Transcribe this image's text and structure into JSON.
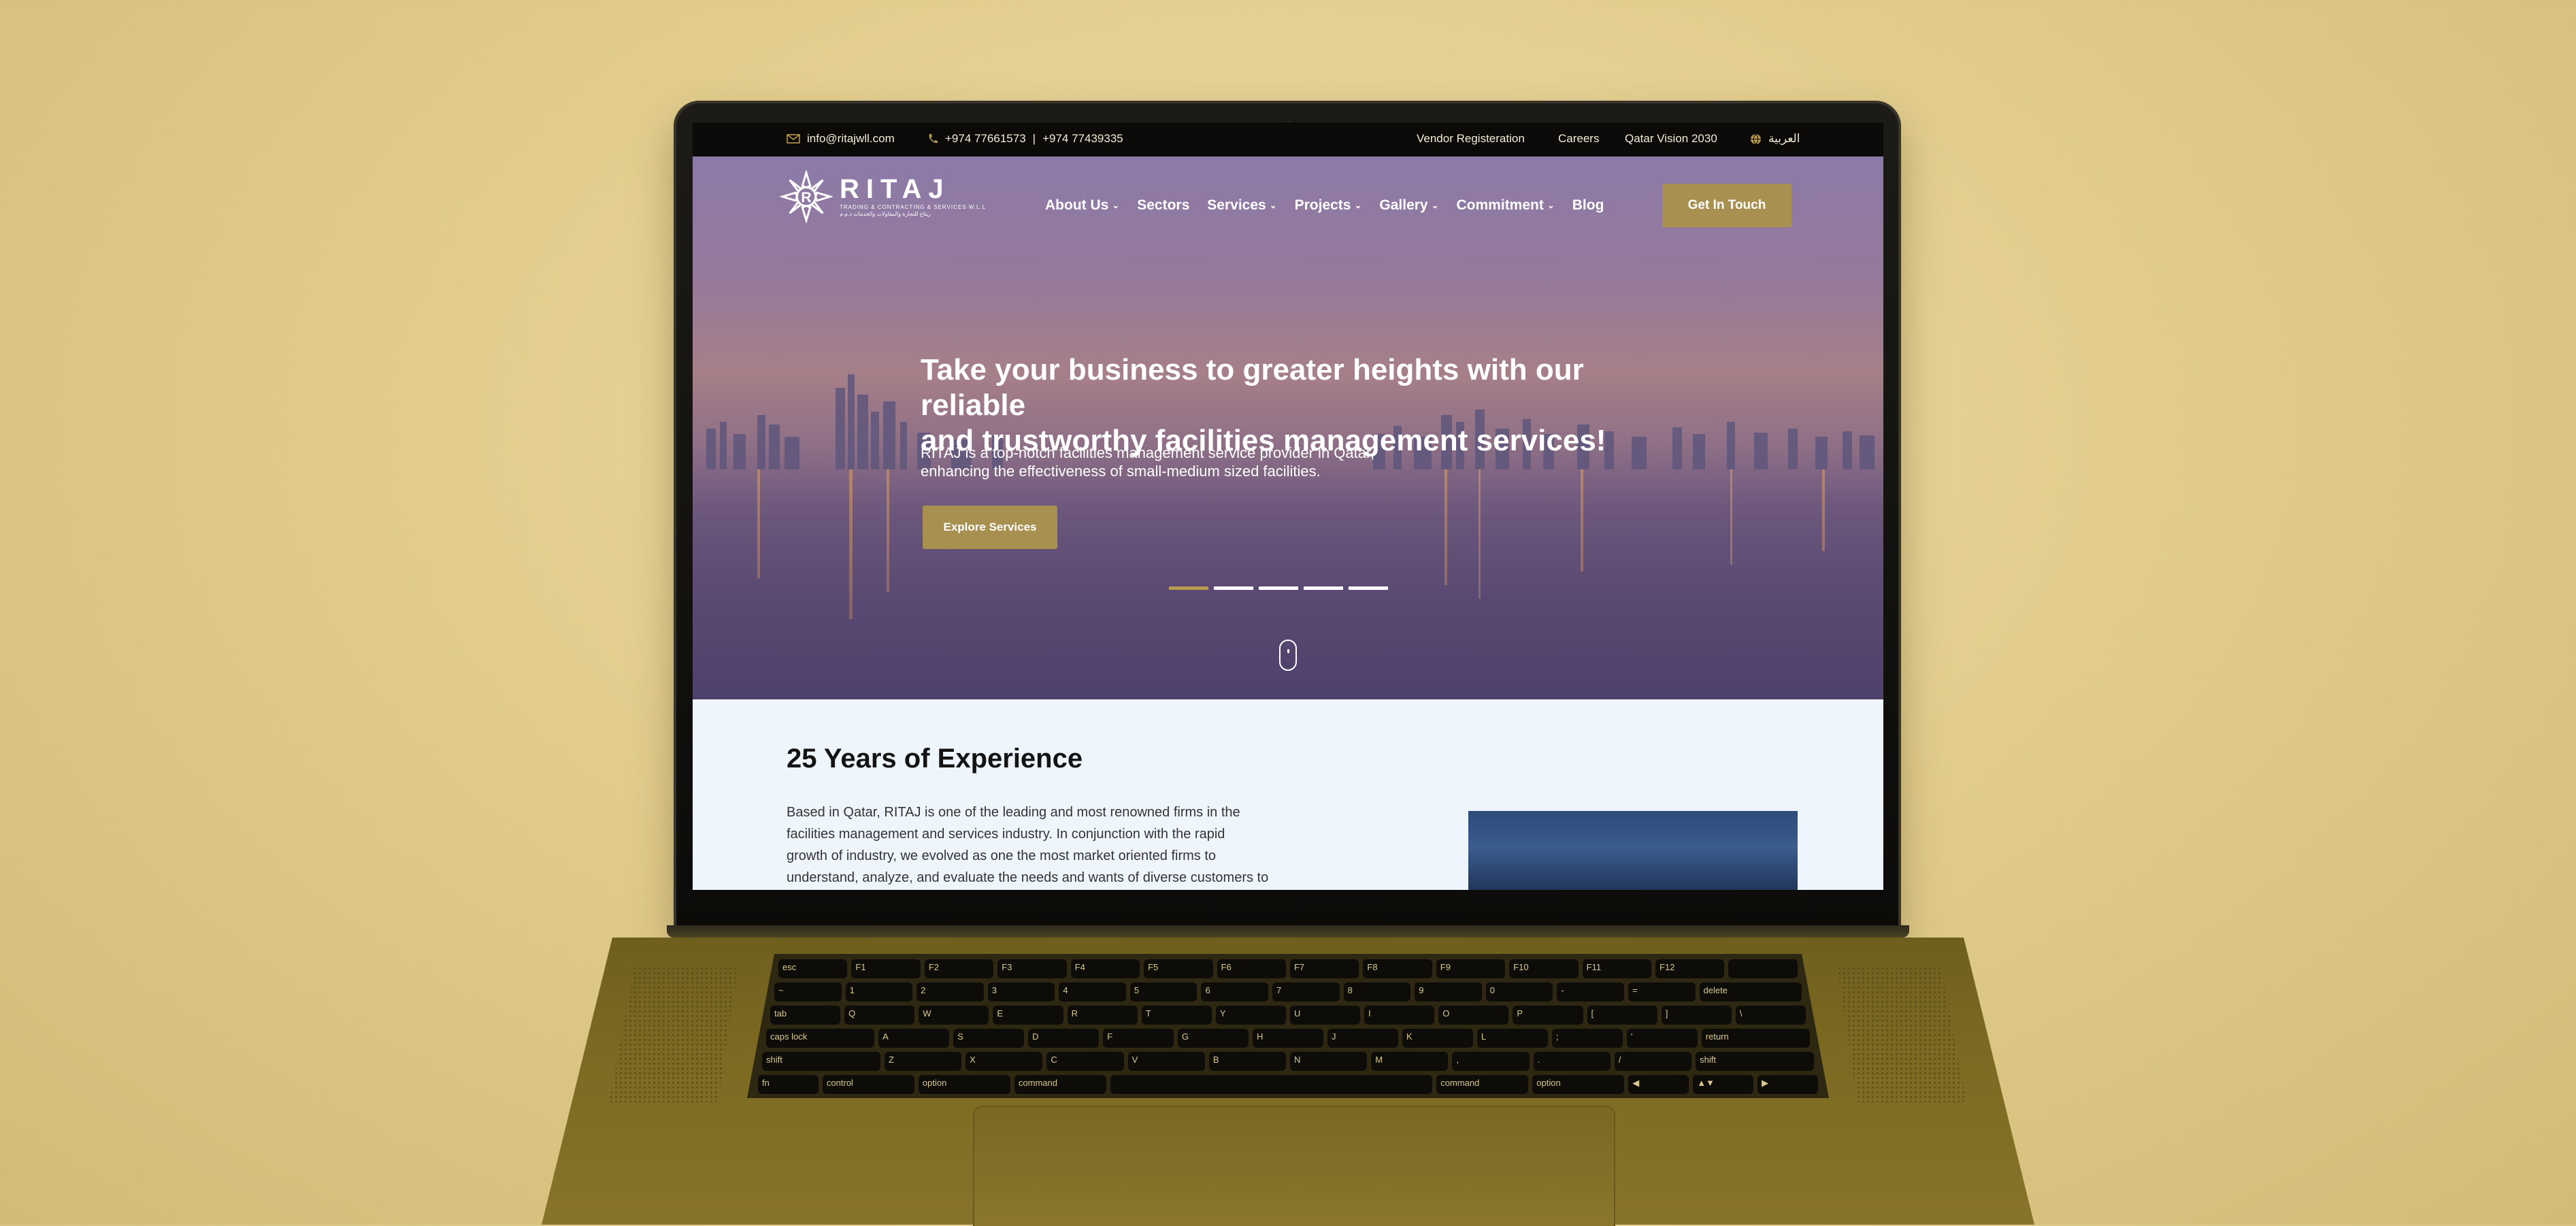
{
  "topbar": {
    "email": "info@ritajwll.com",
    "phone1": "+974 77661573",
    "separator": "|",
    "phone2": "+974 77439335",
    "links": [
      "Vendor Registeration",
      "Careers",
      "Qatar Vision 2030"
    ],
    "language": "العربية"
  },
  "brand": {
    "name": "RITAJ",
    "tagline": "TRADING & CONTRACTING & SERVICES W.L.L",
    "tagline_ar": "ريتاج للتجارة والمقاولات والخدمات ذ.م.م"
  },
  "nav": {
    "items": [
      {
        "label": "About Us",
        "dropdown": true
      },
      {
        "label": "Sectors",
        "dropdown": false
      },
      {
        "label": "Services",
        "dropdown": true
      },
      {
        "label": "Projects",
        "dropdown": true
      },
      {
        "label": "Gallery",
        "dropdown": true
      },
      {
        "label": "Commitment",
        "dropdown": true
      },
      {
        "label": "Blog",
        "dropdown": false
      }
    ],
    "cta": "Get In Touch",
    "caret": "⌄"
  },
  "hero": {
    "title_line1": "Take your business to greater heights with our reliable",
    "title_line2": "and trustworthy facilities management services!",
    "sub_line1": "RITAJ is a top-notch facilities management service provider in Qatar,",
    "sub_line2": "enhancing the effectiveness of small-medium sized facilities.",
    "button": "Explore Services",
    "slides": 5,
    "active_slide": 1
  },
  "about": {
    "title": "25 Years of Experience",
    "lines": [
      "Based in Qatar, RITAJ is one of the leading and most renowned firms in the",
      "facilities management and services industry. In conjunction with the rapid",
      "growth of industry, we evolved as one the most market oriented firms to",
      "understand, analyze, and evaluate the needs and wants of diverse customers to"
    ]
  },
  "keyboard": {
    "row1": [
      "esc",
      "F1",
      "F2",
      "F3",
      "F4",
      "F5",
      "F6",
      "F7",
      "F8",
      "F9",
      "F10",
      "F11",
      "F12",
      ""
    ],
    "row2": [
      "~",
      "1",
      "2",
      "3",
      "4",
      "5",
      "6",
      "7",
      "8",
      "9",
      "0",
      "-",
      "=",
      "delete"
    ],
    "row3": [
      "tab",
      "Q",
      "W",
      "E",
      "R",
      "T",
      "Y",
      "U",
      "I",
      "O",
      "P",
      "[",
      "]",
      "\\"
    ],
    "row4": [
      "caps lock",
      "A",
      "S",
      "D",
      "F",
      "G",
      "H",
      "J",
      "K",
      "L",
      ";",
      "'",
      "return"
    ],
    "row5": [
      "shift",
      "Z",
      "X",
      "C",
      "V",
      "B",
      "N",
      "M",
      ",",
      ".",
      "/",
      "shift"
    ],
    "row6": [
      "fn",
      "control",
      "option",
      "command",
      "",
      "command",
      "option",
      "◀",
      "▲▼",
      "▶"
    ]
  },
  "colors": {
    "accent_gold": "#a89150",
    "topbar_bg": "#0b0a08",
    "hero_purple": "#6a5580",
    "page_bg": "#eff5fd",
    "backdrop": "#e2cd8d"
  }
}
